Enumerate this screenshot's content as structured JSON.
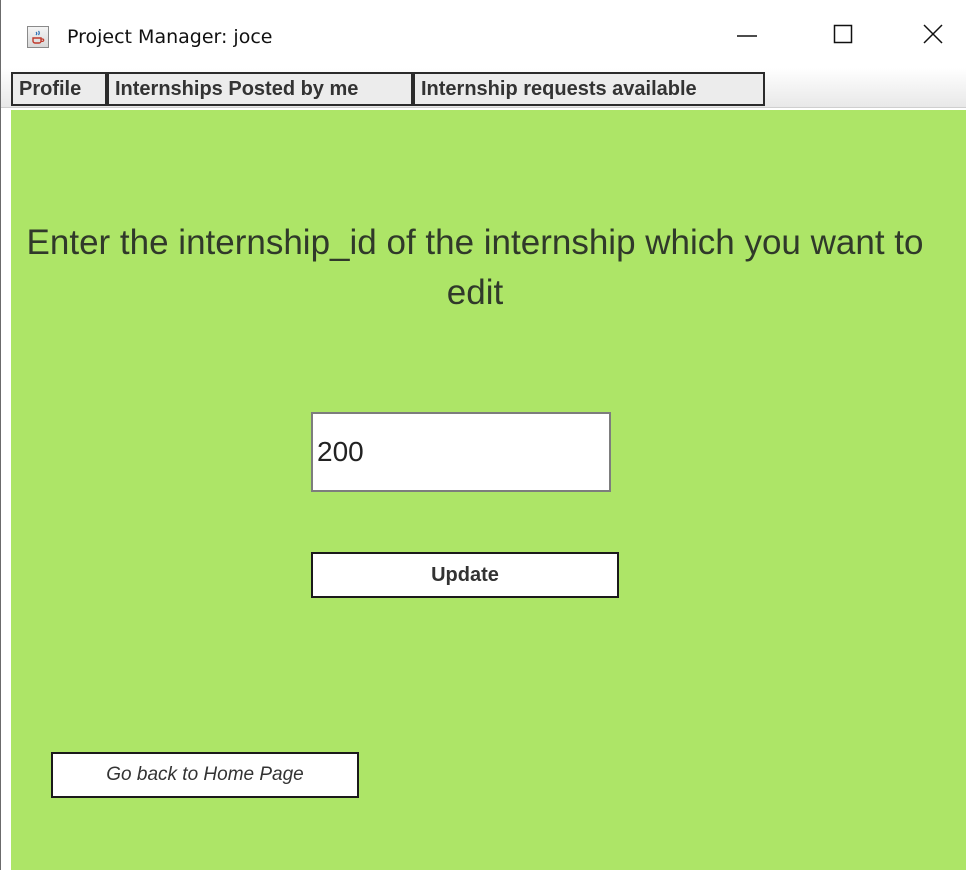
{
  "window": {
    "title": "Project Manager: joce",
    "app_icon": "java-coffee-icon",
    "controls": [
      "minimize-icon",
      "maximize-icon",
      "close-icon"
    ]
  },
  "menubar": {
    "items": [
      {
        "label": "Profile"
      },
      {
        "label": "Internships Posted by me"
      },
      {
        "label": "Internship requests available"
      }
    ]
  },
  "main": {
    "heading": "Enter the internship_id of the internship which you want to edit",
    "id_input": {
      "value": "200",
      "placeholder": ""
    },
    "update_label": "Update",
    "home_label": "Go back to Home Page"
  },
  "colors": {
    "background": "#ade567",
    "text": "#30392a"
  }
}
